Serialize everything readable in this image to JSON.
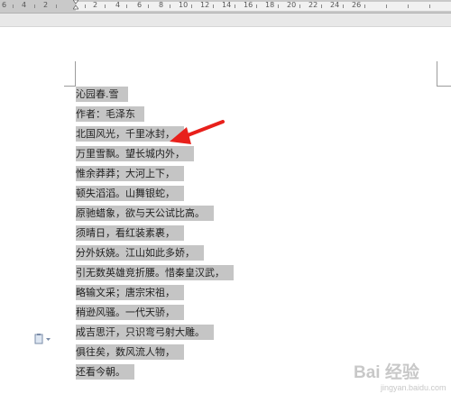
{
  "ruler": {
    "numbers": [
      "6",
      "4",
      "2",
      "2",
      "4",
      "6",
      "8",
      "10",
      "12",
      "14",
      "16",
      "18",
      "20",
      "22",
      "24",
      "26"
    ]
  },
  "document": {
    "lines": [
      "沁园春.雪",
      "作者：毛泽东",
      "北国风光，千里冰封，",
      "万里雪飘。望长城内外，",
      "惟余莽莽；大河上下，",
      "顿失滔滔。山舞银蛇，",
      "原驰蜡象，欲与天公试比高。",
      "须晴日，看红装素裹，",
      "分外妖娆。江山如此多娇，",
      "引无数英雄竞折腰。惜秦皇汉武，",
      "略输文采；唐宗宋祖，",
      "稍逊风骚。一代天骄，",
      "成吉思汗，只识弯弓射大雕。",
      "俱往矣，数风流人物，",
      "还看今朝。"
    ]
  },
  "watermark": {
    "main": "Bai 经验",
    "sub": "jingyan.baidu.com"
  },
  "colors": {
    "selection": "#c5c5c5",
    "arrow": "#e8201b"
  },
  "icons": {
    "paste_options": "clipboard-icon",
    "annotation": "red-arrow"
  }
}
